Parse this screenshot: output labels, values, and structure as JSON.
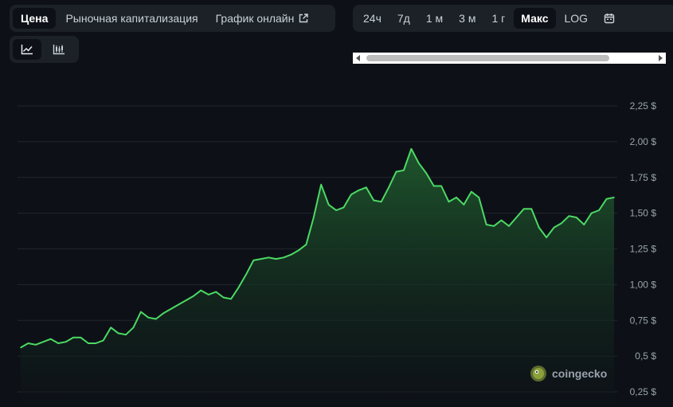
{
  "view_tabs": [
    {
      "label": "Цена",
      "active": true
    },
    {
      "label": "Рыночная капитализация",
      "active": false
    },
    {
      "label": "График онлайн",
      "active": false
    }
  ],
  "ranges": [
    {
      "label": "24ч",
      "active": false
    },
    {
      "label": "7д",
      "active": false
    },
    {
      "label": "1 м",
      "active": false
    },
    {
      "label": "3 м",
      "active": false
    },
    {
      "label": "1 г",
      "active": false
    },
    {
      "label": "Макс",
      "active": true
    },
    {
      "label": "LOG",
      "active": false
    }
  ],
  "icons": {
    "external_link": "external-link-icon",
    "calendar": "calendar-icon",
    "line_chart": "line-chart-icon",
    "candle_chart": "candlestick-chart-icon",
    "watermark_logo": "coingecko-logo-icon"
  },
  "watermark": "coingecko",
  "colors": {
    "background": "#0d1117",
    "line": "#4cd964",
    "fill_top": "#1f5a2d",
    "grid": "#21262d"
  },
  "chart_data": {
    "type": "area",
    "yticks": [
      "0,25 $",
      "0,5 $",
      "0,75 $",
      "1,00 $",
      "1,25 $",
      "1,50 $",
      "1,75 $",
      "2,00 $",
      "2,25 $"
    ],
    "ytick_values": [
      0.25,
      0.5,
      0.75,
      1.0,
      1.25,
      1.5,
      1.75,
      2.0,
      2.25
    ],
    "ylim": [
      0.25,
      2.25
    ],
    "grid": true,
    "series": [
      {
        "values": [
          0.56,
          0.59,
          0.58,
          0.6,
          0.62,
          0.59,
          0.6,
          0.63,
          0.63,
          0.59,
          0.59,
          0.61,
          0.7,
          0.66,
          0.65,
          0.7,
          0.81,
          0.77,
          0.76,
          0.8,
          0.83,
          0.86,
          0.89,
          0.92,
          0.96,
          0.93,
          0.95,
          0.91,
          0.9,
          0.98,
          1.07,
          1.17,
          1.18,
          1.19,
          1.18,
          1.19,
          1.21,
          1.24,
          1.28,
          1.47,
          1.7,
          1.56,
          1.52,
          1.54,
          1.63,
          1.66,
          1.68,
          1.59,
          1.58,
          1.68,
          1.79,
          1.8,
          1.95,
          1.85,
          1.78,
          1.69,
          1.69,
          1.58,
          1.61,
          1.56,
          1.65,
          1.61,
          1.42,
          1.41,
          1.45,
          1.41,
          1.47,
          1.53,
          1.53,
          1.4,
          1.33,
          1.4,
          1.43,
          1.48,
          1.47,
          1.42,
          1.5,
          1.52,
          1.6,
          1.61
        ]
      }
    ]
  }
}
